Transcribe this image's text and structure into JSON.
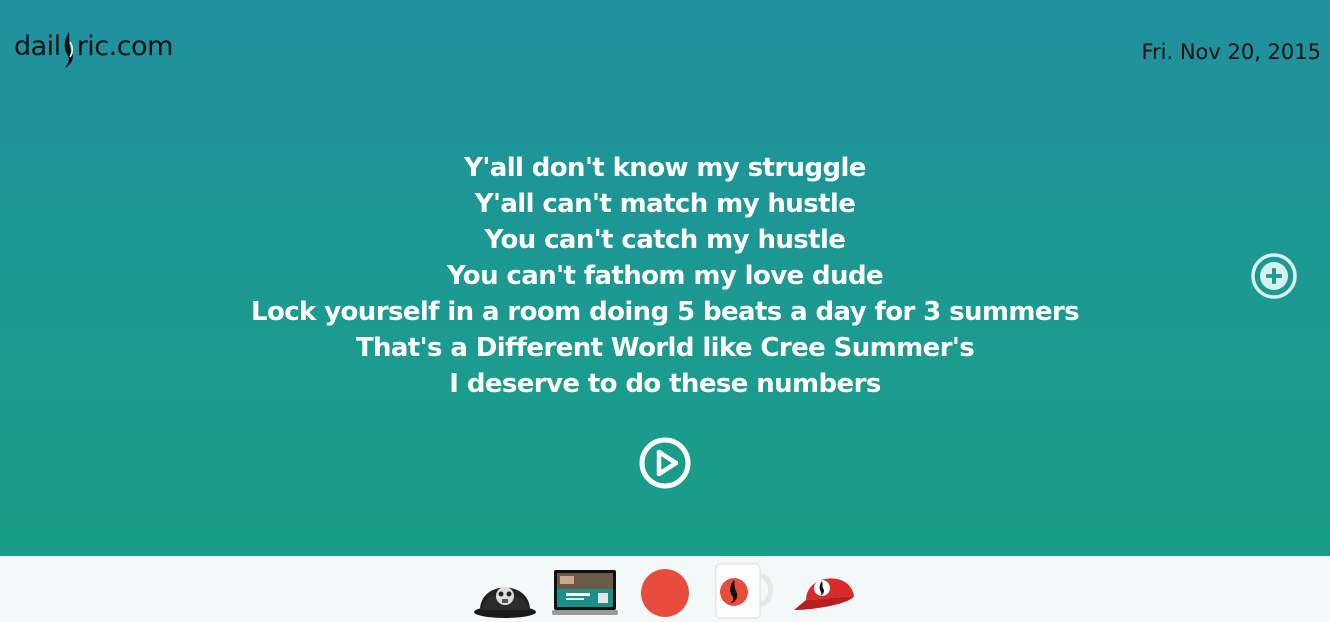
{
  "header": {
    "logo_text_left": "dail",
    "logo_text_right": "ric.com",
    "date": "Fri. Nov 20, 2015"
  },
  "lyrics": {
    "lines": [
      "Y'all don't know my struggle",
      "Y'all can't match my hustle",
      "You can't catch my hustle",
      "You can't fathom my love dude",
      "Lock yourself in a room doing 5 beats a day for 3 summers",
      "That's a Different World like Cree Summer's",
      "I deserve to do these numbers"
    ]
  },
  "controls": {
    "plus_icon": "plus-circle-icon",
    "play_icon": "play-circle-icon"
  },
  "footer": {
    "products": [
      {
        "name": "black-snapback-hat",
        "icon": "hat-icon"
      },
      {
        "name": "laptop-screen",
        "icon": "laptop-icon"
      },
      {
        "name": "red-circle-sticker",
        "icon": "circle-icon"
      },
      {
        "name": "logo-mug",
        "icon": "mug-icon"
      },
      {
        "name": "red-cap",
        "icon": "cap-icon"
      }
    ]
  },
  "colors": {
    "bg_top": "#20909f",
    "bg_bottom": "#179d84",
    "footer_bg": "#f3f8f8",
    "accent_red": "#e74c3c"
  }
}
